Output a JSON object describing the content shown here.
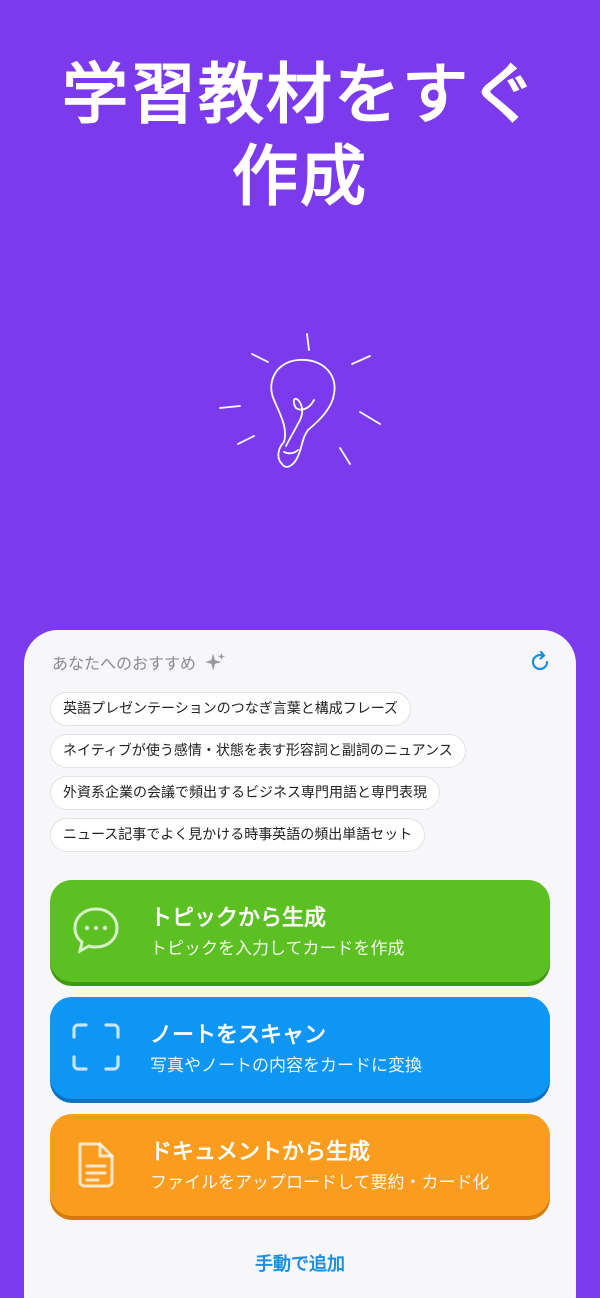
{
  "hero": {
    "line1": "学習教材をすぐ",
    "line2": "作成"
  },
  "recommend": {
    "header": "あなたへのおすすめ",
    "chips": [
      "英語プレゼンテーションのつなぎ言葉と構成フレーズ",
      "ネイティブが使う感情・状態を表す形容詞と副詞のニュアンス",
      "外資系企業の会議で頻出するビジネス専門用語と専門表現",
      "ニュース記事でよく見かける時事英語の頻出単語セット"
    ]
  },
  "actions": [
    {
      "title": "トピックから生成",
      "subtitle": "トピックを入力してカードを作成",
      "icon": "chat-bubble-icon",
      "color": "#5cbf22"
    },
    {
      "title": "ノートをスキャン",
      "subtitle": "写真やノートの内容をカードに変換",
      "icon": "scan-frame-icon",
      "color": "#0d96f3"
    },
    {
      "title": "ドキュメントから生成",
      "subtitle": "ファイルをアップロードして要約・カード化",
      "icon": "document-icon",
      "color": "#fa9c1e"
    }
  ],
  "manual_add": "手動で追加"
}
